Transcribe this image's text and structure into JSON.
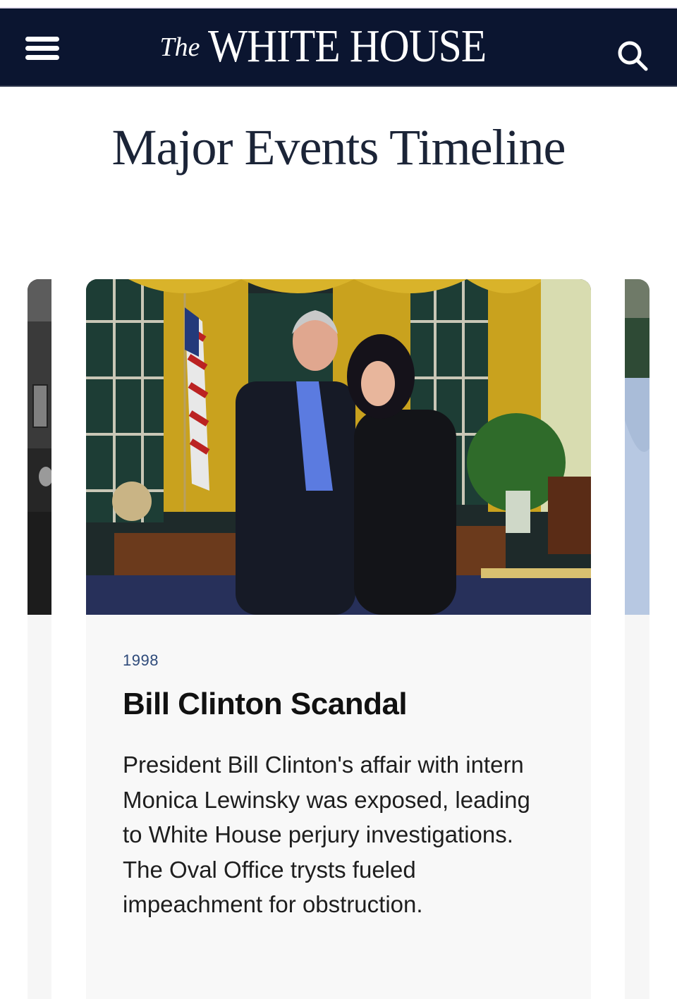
{
  "header": {
    "logo_prefix": "The",
    "logo_name": "WHITE HOUSE",
    "menu_icon": "hamburger-menu-icon",
    "search_icon": "search-icon",
    "background_color": "#0b1530"
  },
  "page": {
    "title": "Major Events Timeline"
  },
  "carousel": {
    "active_card": {
      "year": "1998",
      "title": "Bill Clinton Scandal",
      "description": "President Bill Clinton's affair with intern Monica Lewinsky was exposed, leading to White House perjury investigations. The Oval Office trysts fueled impeachment for obstruction."
    }
  }
}
